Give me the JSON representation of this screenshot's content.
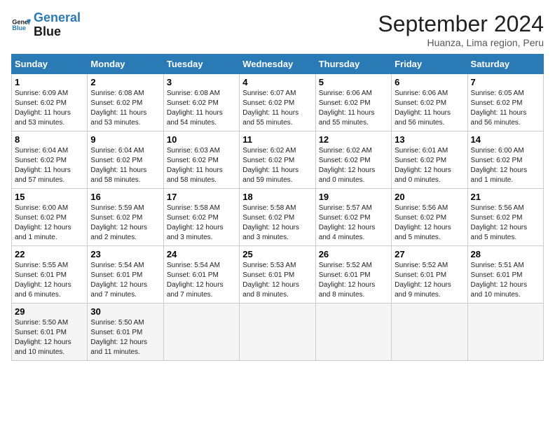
{
  "logo": {
    "line1": "General",
    "line2": "Blue"
  },
  "title": "September 2024",
  "location": "Huanza, Lima region, Peru",
  "days_of_week": [
    "Sunday",
    "Monday",
    "Tuesday",
    "Wednesday",
    "Thursday",
    "Friday",
    "Saturday"
  ],
  "weeks": [
    [
      {
        "day": "1",
        "info": "Sunrise: 6:09 AM\nSunset: 6:02 PM\nDaylight: 11 hours\nand 53 minutes."
      },
      {
        "day": "2",
        "info": "Sunrise: 6:08 AM\nSunset: 6:02 PM\nDaylight: 11 hours\nand 53 minutes."
      },
      {
        "day": "3",
        "info": "Sunrise: 6:08 AM\nSunset: 6:02 PM\nDaylight: 11 hours\nand 54 minutes."
      },
      {
        "day": "4",
        "info": "Sunrise: 6:07 AM\nSunset: 6:02 PM\nDaylight: 11 hours\nand 55 minutes."
      },
      {
        "day": "5",
        "info": "Sunrise: 6:06 AM\nSunset: 6:02 PM\nDaylight: 11 hours\nand 55 minutes."
      },
      {
        "day": "6",
        "info": "Sunrise: 6:06 AM\nSunset: 6:02 PM\nDaylight: 11 hours\nand 56 minutes."
      },
      {
        "day": "7",
        "info": "Sunrise: 6:05 AM\nSunset: 6:02 PM\nDaylight: 11 hours\nand 56 minutes."
      }
    ],
    [
      {
        "day": "8",
        "info": "Sunrise: 6:04 AM\nSunset: 6:02 PM\nDaylight: 11 hours\nand 57 minutes."
      },
      {
        "day": "9",
        "info": "Sunrise: 6:04 AM\nSunset: 6:02 PM\nDaylight: 11 hours\nand 58 minutes."
      },
      {
        "day": "10",
        "info": "Sunrise: 6:03 AM\nSunset: 6:02 PM\nDaylight: 11 hours\nand 58 minutes."
      },
      {
        "day": "11",
        "info": "Sunrise: 6:02 AM\nSunset: 6:02 PM\nDaylight: 11 hours\nand 59 minutes."
      },
      {
        "day": "12",
        "info": "Sunrise: 6:02 AM\nSunset: 6:02 PM\nDaylight: 12 hours\nand 0 minutes."
      },
      {
        "day": "13",
        "info": "Sunrise: 6:01 AM\nSunset: 6:02 PM\nDaylight: 12 hours\nand 0 minutes."
      },
      {
        "day": "14",
        "info": "Sunrise: 6:00 AM\nSunset: 6:02 PM\nDaylight: 12 hours\nand 1 minute."
      }
    ],
    [
      {
        "day": "15",
        "info": "Sunrise: 6:00 AM\nSunset: 6:02 PM\nDaylight: 12 hours\nand 1 minute."
      },
      {
        "day": "16",
        "info": "Sunrise: 5:59 AM\nSunset: 6:02 PM\nDaylight: 12 hours\nand 2 minutes."
      },
      {
        "day": "17",
        "info": "Sunrise: 5:58 AM\nSunset: 6:02 PM\nDaylight: 12 hours\nand 3 minutes."
      },
      {
        "day": "18",
        "info": "Sunrise: 5:58 AM\nSunset: 6:02 PM\nDaylight: 12 hours\nand 3 minutes."
      },
      {
        "day": "19",
        "info": "Sunrise: 5:57 AM\nSunset: 6:02 PM\nDaylight: 12 hours\nand 4 minutes."
      },
      {
        "day": "20",
        "info": "Sunrise: 5:56 AM\nSunset: 6:02 PM\nDaylight: 12 hours\nand 5 minutes."
      },
      {
        "day": "21",
        "info": "Sunrise: 5:56 AM\nSunset: 6:02 PM\nDaylight: 12 hours\nand 5 minutes."
      }
    ],
    [
      {
        "day": "22",
        "info": "Sunrise: 5:55 AM\nSunset: 6:01 PM\nDaylight: 12 hours\nand 6 minutes."
      },
      {
        "day": "23",
        "info": "Sunrise: 5:54 AM\nSunset: 6:01 PM\nDaylight: 12 hours\nand 7 minutes."
      },
      {
        "day": "24",
        "info": "Sunrise: 5:54 AM\nSunset: 6:01 PM\nDaylight: 12 hours\nand 7 minutes."
      },
      {
        "day": "25",
        "info": "Sunrise: 5:53 AM\nSunset: 6:01 PM\nDaylight: 12 hours\nand 8 minutes."
      },
      {
        "day": "26",
        "info": "Sunrise: 5:52 AM\nSunset: 6:01 PM\nDaylight: 12 hours\nand 8 minutes."
      },
      {
        "day": "27",
        "info": "Sunrise: 5:52 AM\nSunset: 6:01 PM\nDaylight: 12 hours\nand 9 minutes."
      },
      {
        "day": "28",
        "info": "Sunrise: 5:51 AM\nSunset: 6:01 PM\nDaylight: 12 hours\nand 10 minutes."
      }
    ],
    [
      {
        "day": "29",
        "info": "Sunrise: 5:50 AM\nSunset: 6:01 PM\nDaylight: 12 hours\nand 10 minutes."
      },
      {
        "day": "30",
        "info": "Sunrise: 5:50 AM\nSunset: 6:01 PM\nDaylight: 12 hours\nand 11 minutes."
      },
      {
        "day": "",
        "info": ""
      },
      {
        "day": "",
        "info": ""
      },
      {
        "day": "",
        "info": ""
      },
      {
        "day": "",
        "info": ""
      },
      {
        "day": "",
        "info": ""
      }
    ]
  ]
}
